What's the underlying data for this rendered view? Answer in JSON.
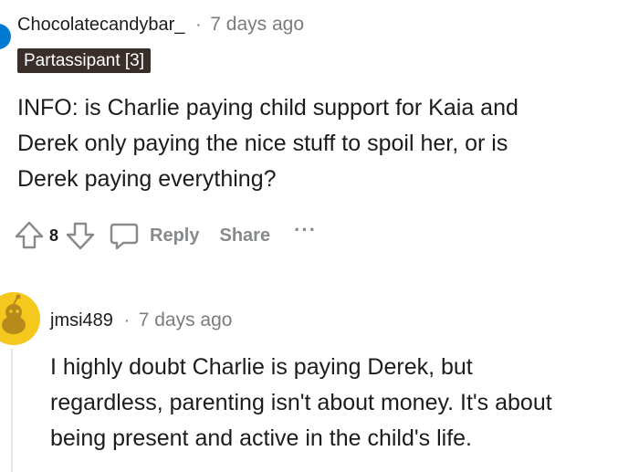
{
  "comments": [
    {
      "username": "Chocolatecandybar_",
      "separator": "·",
      "timestamp": "7 days ago",
      "flair": "Partassipant [3]",
      "body_lines": [
        "INFO: is Charlie paying child support for Kaia and",
        "Derek only paying the nice stuff to spoil her, or is",
        "Derek paying everything?"
      ],
      "score": "8",
      "actions": {
        "reply_label": "Reply",
        "share_label": "Share",
        "more_label": "···"
      }
    },
    {
      "username": "jmsi489",
      "separator": "·",
      "timestamp": "7 days ago",
      "body_lines": [
        "I highly doubt Charlie is paying Derek, but",
        "regardless, parenting isn't about money. It's about",
        "being present and active in the child's life."
      ]
    }
  ],
  "colors": {
    "flair_bg": "#3a2e2a",
    "meta_text": "#7c7c7c",
    "action_text": "#878a8c",
    "avatar1": "#0079d3",
    "avatar2": "#f5c81e"
  },
  "icons": {
    "upvote": "arrow-up-icon",
    "downvote": "arrow-down-icon",
    "reply": "speech-bubble-icon",
    "avatar": "snoo-avatar-icon"
  }
}
